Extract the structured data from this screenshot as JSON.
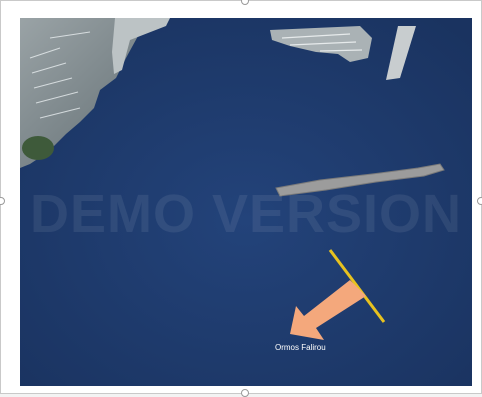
{
  "document": {
    "watermark_text": "DEMO VERSION",
    "location_label": "Ormos Falirou"
  },
  "colors": {
    "sea": "#1f3a66",
    "arrow": "#f4a87c",
    "line": "#e8c21f",
    "pier": "#8a8a8a"
  },
  "icons": {
    "direction_arrow": "arrow-down-left-icon",
    "boundary_line": "yellow-line"
  }
}
